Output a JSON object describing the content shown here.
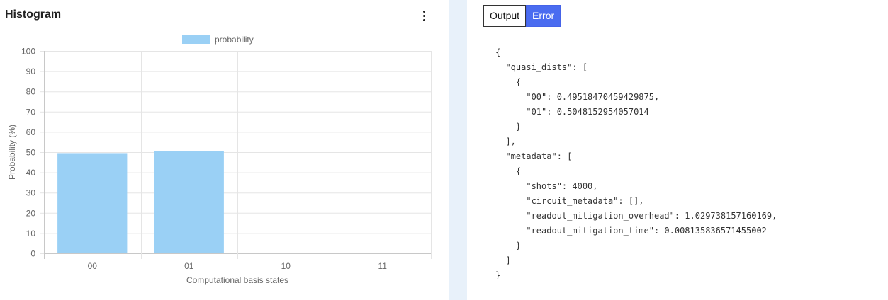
{
  "panel": {
    "title": "Histogram",
    "menu_icon": "kebab-menu-icon"
  },
  "chart_data": {
    "type": "bar",
    "categories": [
      "00",
      "01",
      "10",
      "11"
    ],
    "series": [
      {
        "name": "probability",
        "values": [
          49.5,
          50.5,
          0,
          0
        ],
        "color": "#9ad0f5"
      }
    ],
    "xlabel": "Computational basis states",
    "ylabel": "Probability (%)",
    "ylim": [
      0,
      100
    ],
    "yticks": [
      "0",
      "10",
      "20",
      "30",
      "40",
      "50",
      "60",
      "70",
      "80",
      "90",
      "100"
    ],
    "grid": true,
    "legend": "top-center"
  },
  "tabs": [
    {
      "label": "Output",
      "active": false
    },
    {
      "label": "Error",
      "active": true
    }
  ],
  "colors": {
    "bar": "#9ad0f5",
    "accent": "#4a6cf0",
    "divider": "#e8f1fa"
  },
  "output_json": "{\n  \"quasi_dists\": [\n    {\n      \"00\": 0.49518470459429875,\n      \"01\": 0.5048152954057014\n    }\n  ],\n  \"metadata\": [\n    {\n      \"shots\": 4000,\n      \"circuit_metadata\": [],\n      \"readout_mitigation_overhead\": 1.029738157160169,\n      \"readout_mitigation_time\": 0.008135836571455002\n    }\n  ]\n}"
}
